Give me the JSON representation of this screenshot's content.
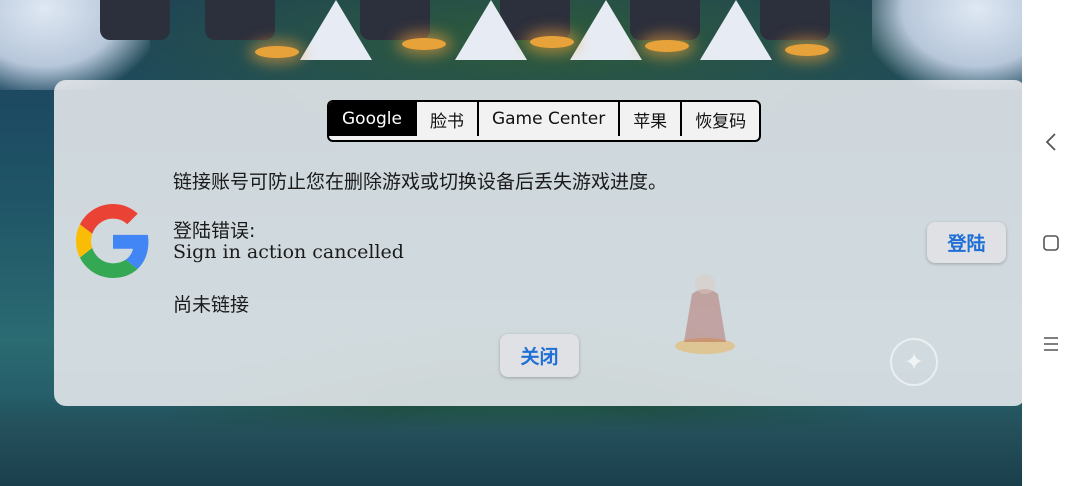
{
  "tabs": [
    {
      "label": "Google",
      "active": true
    },
    {
      "label": "脸书",
      "active": false
    },
    {
      "label": "Game Center",
      "active": false
    },
    {
      "label": "苹果",
      "active": false
    },
    {
      "label": "恢复码",
      "active": false
    }
  ],
  "dialog": {
    "intro": "链接账号可防止您在删除游戏或切换设备后丢失游戏进度。",
    "error_title": "登陆错误:",
    "error_message": "Sign in action cancelled",
    "status": "尚未链接",
    "login_label": "登陆",
    "close_label": "关闭"
  },
  "icons": {
    "provider_logo": "google-logo-icon",
    "compass": "compass-icon",
    "nav_back": "chevron-left-icon",
    "nav_home": "square-icon",
    "nav_menu": "menu-icon"
  },
  "colors": {
    "button_text": "#1f6fd6",
    "active_tab_bg": "#000000",
    "dialog_bg": "#e8ebee"
  }
}
